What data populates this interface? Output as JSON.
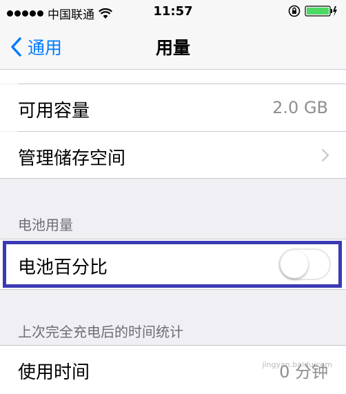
{
  "status_bar": {
    "carrier": "中国联通",
    "time": "11:57",
    "signal_dots": 5,
    "icons": [
      "signal-icon",
      "wifi-icon",
      "rotation-lock-icon",
      "battery-icon"
    ],
    "battery_color": "#4cd964"
  },
  "nav": {
    "back_label": "通用",
    "title": "用量",
    "accent": "#007aff"
  },
  "storage": {
    "available_label": "可用容量",
    "available_value": "2.0 GB",
    "manage_label": "管理储存空间"
  },
  "battery_section": {
    "header": "电池用量",
    "percentage_label": "电池百分比",
    "percentage_on": false,
    "highlight_color": "#3a3ab4"
  },
  "usage_section": {
    "header": "上次完全充电后的时间统计",
    "usage_label": "使用时间",
    "usage_value": "0 分钟"
  },
  "watermark": "jingyan.baidu.com"
}
